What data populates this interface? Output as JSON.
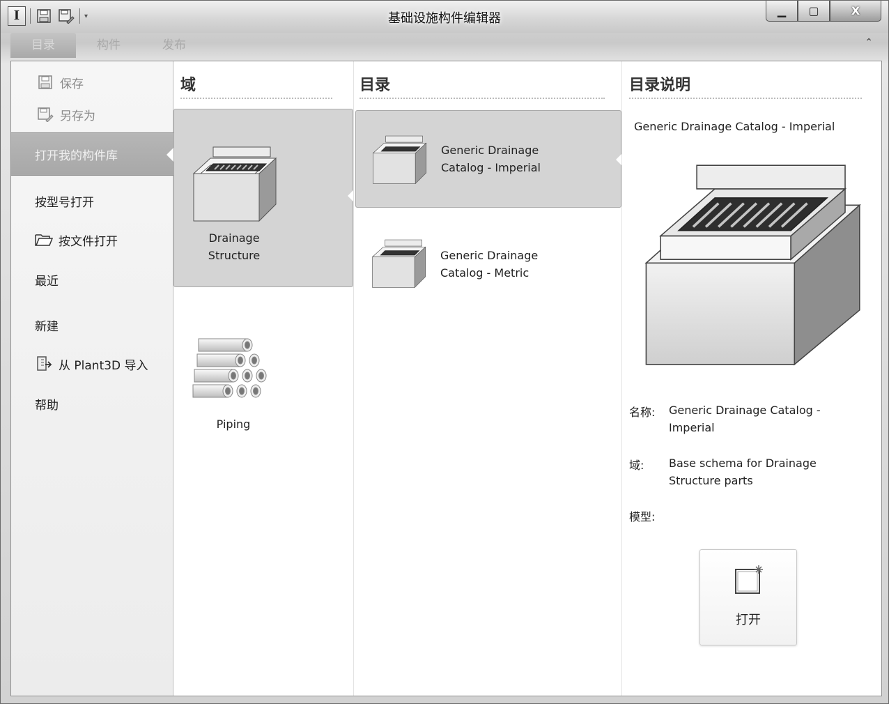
{
  "window": {
    "title": "基础设施构件编辑器",
    "controls": {
      "minimize": "▁",
      "maximize": "▢",
      "close": "X"
    }
  },
  "quick_access": {
    "app_logo": "I",
    "dropdown": "▾"
  },
  "ribbon": {
    "tabs": [
      {
        "label": "目录",
        "active": true
      },
      {
        "label": "构件",
        "active": false
      },
      {
        "label": "发布",
        "active": false
      }
    ],
    "collapse_glyph": "⌃"
  },
  "nav": {
    "save": "保存",
    "save_as": "另存为",
    "open_my_library": "打开我的构件库",
    "open_by_model": "按型号打开",
    "open_by_file": "按文件打开",
    "recent": "最近",
    "new": "新建",
    "import_plant3d": "从 Plant3D 导入",
    "help": "帮助"
  },
  "domain_column": {
    "header": "域",
    "items": [
      {
        "label_line1": "Drainage",
        "label_line2": "Structure",
        "selected": true
      },
      {
        "label_line1": "Piping",
        "label_line2": "",
        "selected": false
      }
    ]
  },
  "catalog_column": {
    "header": "目录",
    "items": [
      {
        "line1": "Generic Drainage",
        "line2": "Catalog - Imperial",
        "selected": true
      },
      {
        "line1": "Generic Drainage",
        "line2": "Catalog - Metric",
        "selected": false
      }
    ]
  },
  "description_column": {
    "header": "目录说明",
    "catalog_title": "Generic Drainage Catalog - Imperial",
    "name_key": "名称:",
    "name_value_line1": "Generic Drainage Catalog -",
    "name_value_line2": "Imperial",
    "domain_key": "域:",
    "domain_value_line1": "Base schema for Drainage",
    "domain_value_line2": "Structure parts",
    "model_key": "模型:",
    "open_button": "打开"
  },
  "icons": {
    "save": "save-icon",
    "save_as": "save-as-icon",
    "open_file": "folder-open-icon",
    "import": "import-icon",
    "drainage": "drainage-structure-icon",
    "piping": "piping-icon",
    "open": "new-document-icon"
  }
}
